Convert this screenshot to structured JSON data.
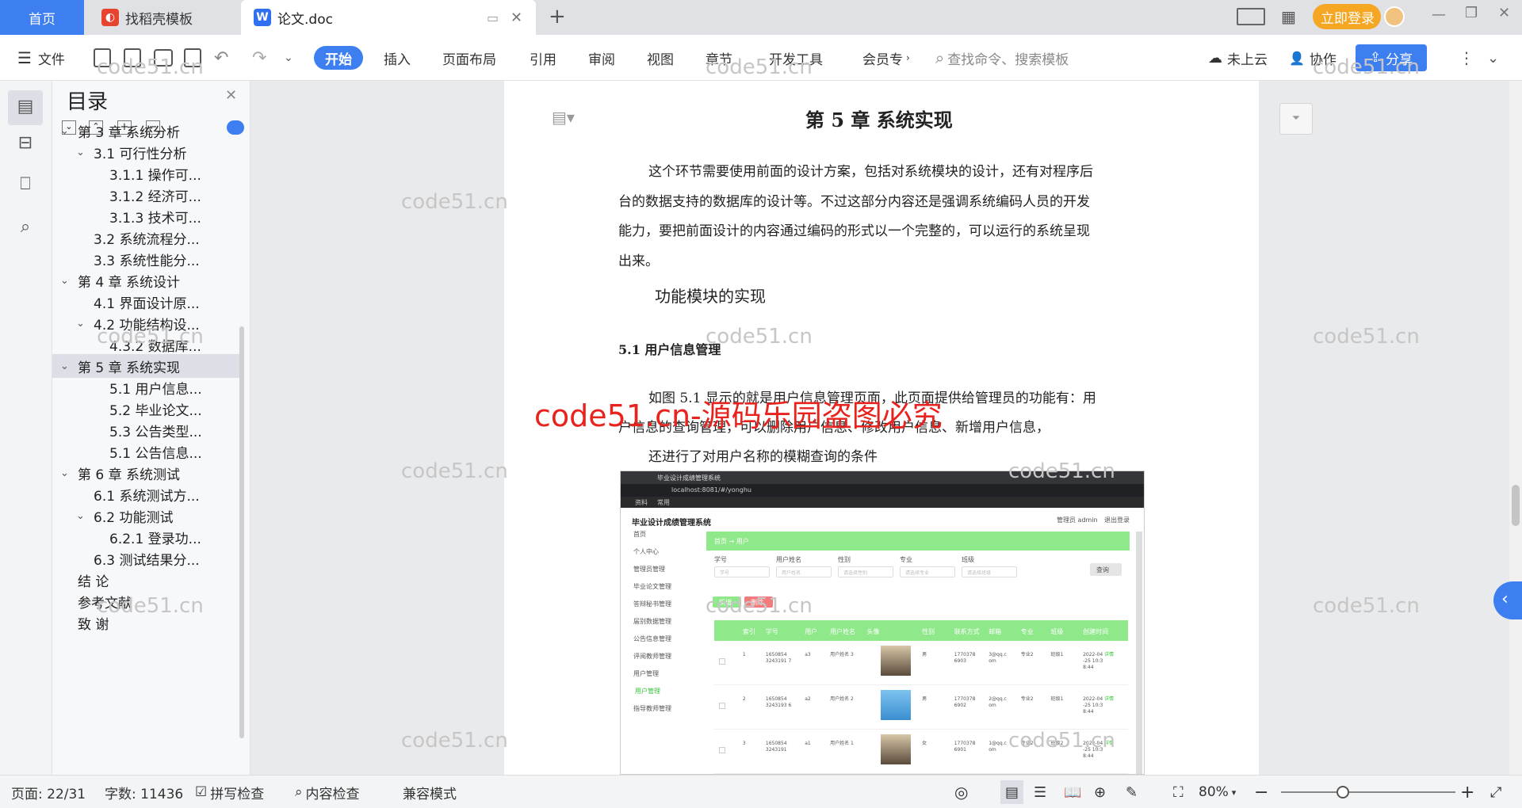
{
  "tabs": {
    "home": "首页",
    "daoke": "找稻壳模板",
    "doc": "论文.doc",
    "login": "立即登录"
  },
  "toolbar": {
    "file": "文件",
    "menus": [
      "开始",
      "插入",
      "页面布局",
      "引用",
      "审阅",
      "视图",
      "章节",
      "开发工具",
      "会员专"
    ],
    "search_placeholder": "查找命令、搜索模板",
    "cloud": "未上云",
    "collab": "协作",
    "share": "分享"
  },
  "toc": {
    "title": "目录",
    "items": [
      {
        "label": "第 3 章  系统分析",
        "level": 1,
        "expanded": true
      },
      {
        "label": "3.1 可行性分析",
        "level": 2,
        "expanded": true
      },
      {
        "label": "3.1.1 操作可...",
        "level": 3
      },
      {
        "label": "3.1.2 经济可...",
        "level": 3
      },
      {
        "label": "3.1.3 技术可...",
        "level": 3
      },
      {
        "label": "3.2 系统流程分...",
        "level": 2
      },
      {
        "label": "3.3 系统性能分...",
        "level": 2
      },
      {
        "label": "第 4 章  系统设计",
        "level": 1,
        "expanded": true
      },
      {
        "label": "4.1 界面设计原...",
        "level": 2
      },
      {
        "label": "4.2 功能结构设...",
        "level": 2,
        "expanded": true
      },
      {
        "label": "4.3.2  数据库...",
        "level": 3
      },
      {
        "label": "第 5 章  系统实现",
        "level": 1,
        "expanded": true,
        "selected": true
      },
      {
        "label": "5.1 用户信息...",
        "level": 3
      },
      {
        "label": "5.2  毕业论文...",
        "level": 3
      },
      {
        "label": "5.3 公告类型...",
        "level": 3
      },
      {
        "label": "5.1 公告信息...",
        "level": 3
      },
      {
        "label": "第 6 章  系统测试",
        "level": 1,
        "expanded": true
      },
      {
        "label": "6.1  系统测试方...",
        "level": 2
      },
      {
        "label": "6.2  功能测试",
        "level": 2,
        "expanded": true
      },
      {
        "label": "6.2.1  登录功...",
        "level": 3
      },
      {
        "label": "6.3  测试结果分...",
        "level": 2
      },
      {
        "label": "结    论",
        "level": 1
      },
      {
        "label": "参考文献",
        "level": 1
      },
      {
        "label": "致    谢",
        "level": 1
      }
    ]
  },
  "document": {
    "chapter_title": "第 5 章  系统实现",
    "para1": [
      "这个环节需要使用前面的设计方案，包括对系统模块的设计，还有对程序后",
      "台的数据支持的数据库的设计等。不过这部分内容还是强调系统编码人员的开发",
      "能力，要把前面设计的内容通过编码的形式以一个完整的，可以运行的系统呈现",
      "出来。"
    ],
    "subtitle": "功能模块的实现",
    "section": "5.1 用户信息管理",
    "para2": [
      "如图 5.1 显示的就是用户信息管理页面，此页面提供给管理员的功能有：用",
      "户信息的查询管理，可以删除用户信息、修改用户信息、新增用户信息，",
      "还进行了对用户名称的模糊查询的条件"
    ]
  },
  "watermark": {
    "small": "code51.cn",
    "big": "code51.cn-源码乐园盗图必究"
  },
  "screenshot": {
    "tab_title": "毕业设计成绩管理系统",
    "url": "localhost:8081/#/yonghu",
    "bookmarks": [
      "资料",
      "常用"
    ],
    "app_title": "毕业设计成绩管理系统",
    "user_info": "管理员 admin",
    "logout": "退出登录",
    "menu": [
      "首页",
      "个人中心",
      "管理员管理",
      "毕业论文管理",
      "答辩秘书管理",
      "届别数据管理",
      "公告信息管理",
      "评阅教师管理",
      "用户管理",
      "用户管理",
      "指导教师管理"
    ],
    "breadcrumb": "首页 → 用户",
    "filters": [
      "学号",
      "用户姓名",
      "性别",
      "专业",
      "班级"
    ],
    "filter_placeholders": [
      "学号",
      "用户姓名",
      "请选择性别",
      "请选择专业",
      "请选择班级"
    ],
    "search_btn": "查询",
    "add_btn": "新增",
    "delete_btn": "删除",
    "columns": [
      "",
      "索引",
      "学号",
      "用户",
      "用户姓名",
      "头像",
      "性别",
      "联系方式",
      "邮箱",
      "专业",
      "班级",
      "创建时间",
      ""
    ],
    "rows": [
      {
        "idx": "1",
        "no": "1650854 3243191 7",
        "user": "a3",
        "name": "用户姓名 3",
        "sex": "男",
        "phone": "1770378 6903",
        "email": "3@qq.c om",
        "major": "专业2",
        "cls": "班级1",
        "time": "2022-04 -25 10:3 8:44",
        "op": "详情"
      },
      {
        "idx": "2",
        "no": "1650854 3243193 6",
        "user": "a2",
        "name": "用户姓名 2",
        "sex": "男",
        "phone": "1770378 6902",
        "email": "2@qq.c om",
        "major": "专业2",
        "cls": "班级1",
        "time": "2022-04 -25 10:3 8:44",
        "op": "详情"
      },
      {
        "idx": "3",
        "no": "1650854 3243191",
        "user": "a1",
        "name": "用户姓名 1",
        "sex": "女",
        "phone": "1770378 6901",
        "email": "1@qq.c om",
        "major": "专业2",
        "cls": "班级2",
        "time": "2022-04 -25 10:3 8:44",
        "op": "详情"
      }
    ]
  },
  "status": {
    "page": "页面: 22/31",
    "words": "字数: 11436",
    "spell": "拼写检查",
    "content": "内容检查",
    "compat": "兼容模式",
    "zoom": "80%"
  },
  "colors": {
    "accent": "#3d7ef0",
    "login": "#f5a623",
    "watermark_red": "#e8221d",
    "green_header": "#8fe88a"
  }
}
